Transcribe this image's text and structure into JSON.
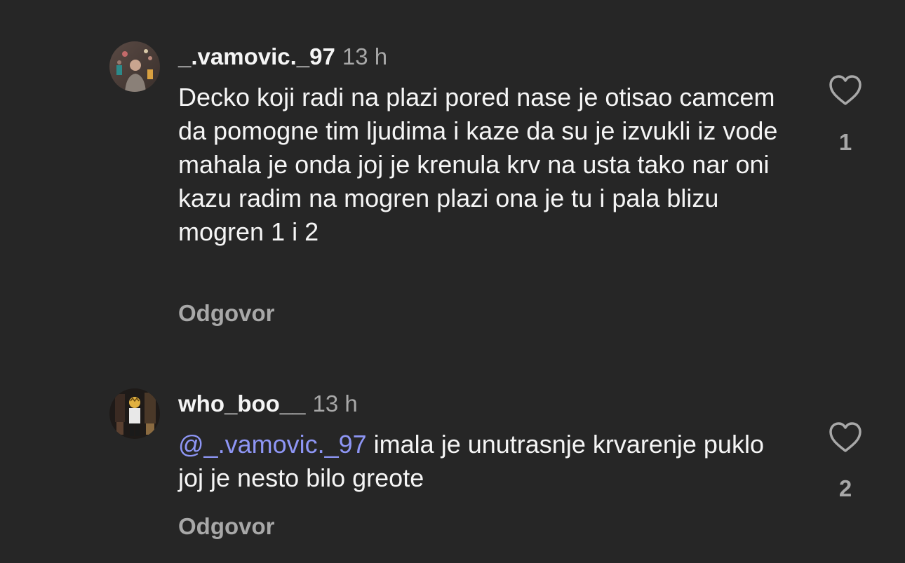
{
  "comments": [
    {
      "username": "_.vamovic._97",
      "time": "13 h",
      "text": "Decko koji radi na plazi pored nase je otisao camcem da pomogne tim ljudima i kaze da su je izvukli iz vode mahala je onda joj je krenula krv na usta tako nar oni kazu radim na mogren plazi ona je tu i pala blizu mogren 1 i 2",
      "reply_label": "Odgovor",
      "like_count": "1",
      "avatar_icon": "profile-photo"
    },
    {
      "username": "who_boo__",
      "time": "13 h",
      "mention": "@_.vamovic._97",
      "text": " imala je unutrasnje krvarenje puklo joj je nesto bilo greote",
      "reply_label": "Odgovor",
      "like_count": "2",
      "avatar_icon": "profile-photo"
    }
  ],
  "colors": {
    "background": "#262626",
    "text": "#f5f5f5",
    "secondary": "#a8a8a8",
    "mention": "#8e96f5"
  },
  "icons": {
    "like": "heart-outline-icon"
  }
}
